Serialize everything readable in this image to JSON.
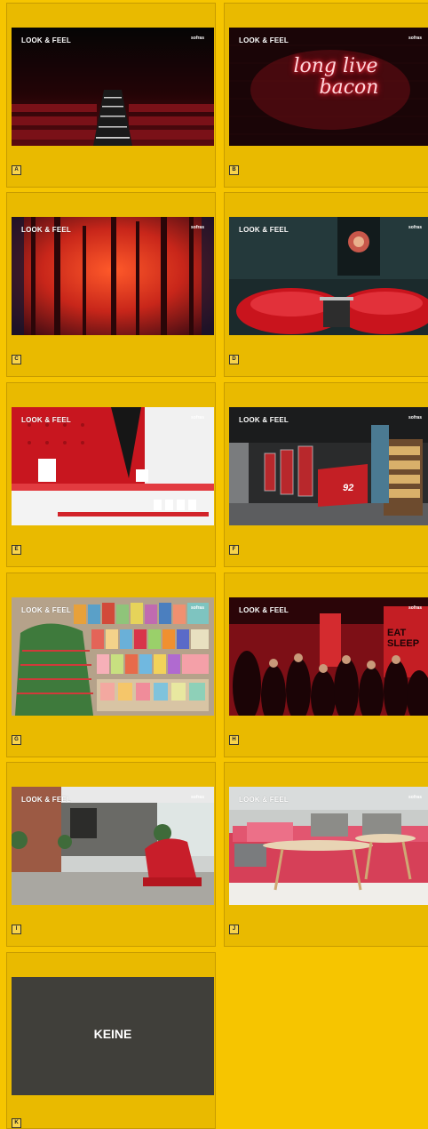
{
  "heading": "LOOK & FEEL",
  "brand": "sofras",
  "options": [
    {
      "label": "A",
      "theme": "cinema-seats"
    },
    {
      "label": "B",
      "theme": "neon-long-live-bacon",
      "neon_text_1": "long live",
      "neon_text_2": "bacon"
    },
    {
      "label": "C",
      "theme": "red-forest"
    },
    {
      "label": "D",
      "theme": "red-lounge-chairs"
    },
    {
      "label": "E",
      "theme": "red-kitchen-pegboard"
    },
    {
      "label": "F",
      "theme": "industrial-interior",
      "room_number": "92"
    },
    {
      "label": "G",
      "theme": "book-stand"
    },
    {
      "label": "H",
      "theme": "party-red-room",
      "sign_text": "EAT SLEEP"
    },
    {
      "label": "I",
      "theme": "loft-red-armchair"
    },
    {
      "label": "J",
      "theme": "pink-sofa-coffee-table"
    },
    {
      "label": "K",
      "theme": "none",
      "center_text": "KEINE"
    }
  ],
  "colors": {
    "page_bg": "#f6c500",
    "card_bg": "#e9ba00",
    "accent_red": "#d2232a"
  }
}
